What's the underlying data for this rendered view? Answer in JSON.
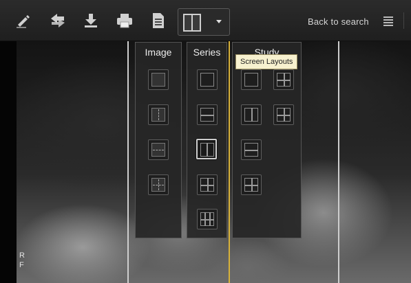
{
  "toolbar": {
    "buttons": [
      {
        "name": "annotate-icon"
      },
      {
        "name": "sync-icon"
      },
      {
        "name": "download-icon"
      },
      {
        "name": "print-icon"
      },
      {
        "name": "document-icon"
      }
    ],
    "layout_dropdown": {
      "icon": "single-split-layout-icon",
      "caret": "chevron-down-icon"
    },
    "back_to_search": "Back to search",
    "list_icon": "list-icon"
  },
  "viewer": {
    "orientation_labels": [
      "R",
      "F"
    ]
  },
  "layouts_menu": {
    "columns": [
      {
        "title": "Image"
      },
      {
        "title": "Series"
      },
      {
        "title": "Study"
      }
    ],
    "tooltip": "Screen Layouts"
  },
  "colors": {
    "active_divider": "#d8b23a",
    "tooltip_bg": "#f7f1cf"
  }
}
